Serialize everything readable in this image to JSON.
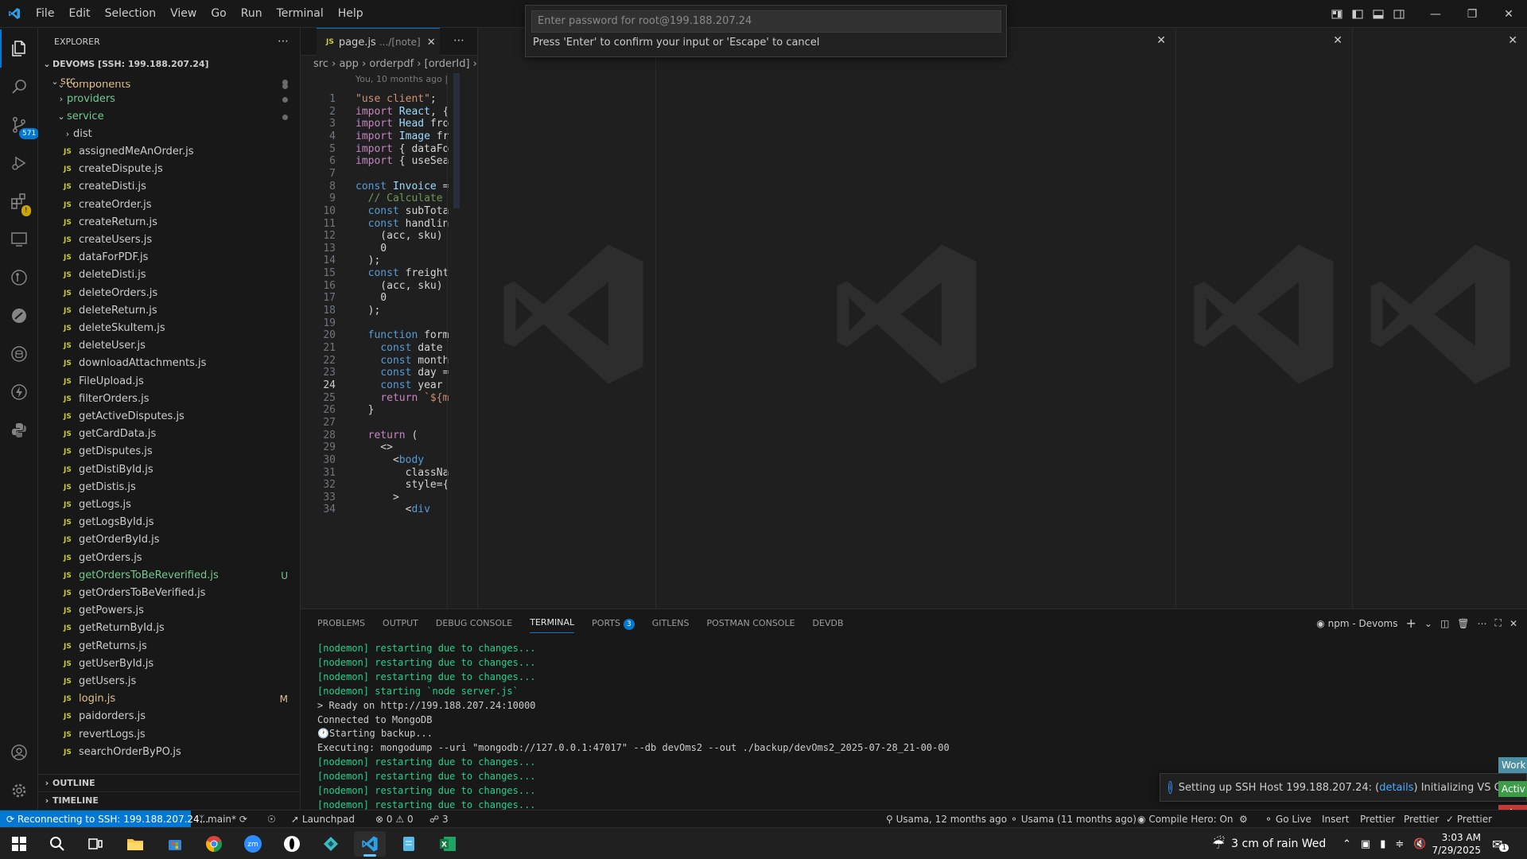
{
  "menu": [
    "File",
    "Edit",
    "Selection",
    "View",
    "Go",
    "Run",
    "Terminal",
    "Help"
  ],
  "quick_input": {
    "placeholder": "Enter password for root@199.188.207.24",
    "message": "Press 'Enter' to confirm your input or 'Escape' to cancel"
  },
  "activity": {
    "source_control_badge": "571"
  },
  "explorer": {
    "title": "EXPLORER",
    "root": "DEVOMS [SSH: 199.188.207.24]",
    "folders": {
      "src": "src",
      "components": "components",
      "providers": "providers",
      "service": "service",
      "dist": "dist"
    },
    "files": [
      {
        "name": "assignedMeAnOrder.js",
        "status": ""
      },
      {
        "name": "createDispute.js",
        "status": ""
      },
      {
        "name": "createDisti.js",
        "status": ""
      },
      {
        "name": "createOrder.js",
        "status": ""
      },
      {
        "name": "createReturn.js",
        "status": ""
      },
      {
        "name": "createUsers.js",
        "status": ""
      },
      {
        "name": "dataForPDF.js",
        "status": ""
      },
      {
        "name": "deleteDisti.js",
        "status": ""
      },
      {
        "name": "deleteOrders.js",
        "status": ""
      },
      {
        "name": "deleteReturn.js",
        "status": ""
      },
      {
        "name": "deleteSkuItem.js",
        "status": ""
      },
      {
        "name": "deleteUser.js",
        "status": ""
      },
      {
        "name": "downloadAttachments.js",
        "status": ""
      },
      {
        "name": "FileUpload.js",
        "status": ""
      },
      {
        "name": "filterOrders.js",
        "status": ""
      },
      {
        "name": "getActiveDisputes.js",
        "status": ""
      },
      {
        "name": "getCardData.js",
        "status": ""
      },
      {
        "name": "getDisputes.js",
        "status": ""
      },
      {
        "name": "getDistiById.js",
        "status": ""
      },
      {
        "name": "getDistis.js",
        "status": ""
      },
      {
        "name": "getLogs.js",
        "status": ""
      },
      {
        "name": "getLogsById.js",
        "status": ""
      },
      {
        "name": "getOrderById.js",
        "status": ""
      },
      {
        "name": "getOrders.js",
        "status": ""
      },
      {
        "name": "getOrdersToBeReverified.js",
        "status": "U"
      },
      {
        "name": "getOrdersToBeVerified.js",
        "status": ""
      },
      {
        "name": "getPowers.js",
        "status": ""
      },
      {
        "name": "getReturnById.js",
        "status": ""
      },
      {
        "name": "getReturns.js",
        "status": ""
      },
      {
        "name": "getUserById.js",
        "status": ""
      },
      {
        "name": "getUsers.js",
        "status": ""
      },
      {
        "name": "login.js",
        "status": "M"
      },
      {
        "name": "paidorders.js",
        "status": ""
      },
      {
        "name": "revertLogs.js",
        "status": ""
      },
      {
        "name": "searchOrderByPO.js",
        "status": ""
      }
    ],
    "outline": "OUTLINE",
    "timeline": "TIMELINE"
  },
  "editor": {
    "tab_label": "page.js",
    "tab_desc": ".../[note]",
    "breadcrumb": [
      "src",
      "app",
      "orderpdf",
      "[orderId]"
    ],
    "blame": "You, 10 months ago |",
    "current_line": 24,
    "lines": [
      "\"use client\";",
      "import React, {",
      "import Head fro",
      "import Image fr",
      "import { dataFo",
      "import { useSea",
      "",
      "const Invoice =",
      "  // Calculate",
      "  const subTota",
      "  const handlin",
      "    (acc, sku)",
      "    0",
      "  );",
      "  const freight",
      "    (acc, sku)",
      "    0",
      "  );",
      "",
      "  function form",
      "    const date",
      "    const month",
      "    const day =",
      "    const year",
      "    return `${m",
      "  }",
      "",
      "  return (",
      "    <>",
      "      <body",
      "        classNa",
      "        style={",
      "      >",
      "        <div"
    ]
  },
  "panel": {
    "tabs": [
      "PROBLEMS",
      "OUTPUT",
      "DEBUG CONSOLE",
      "TERMINAL",
      "PORTS",
      "GITLENS",
      "POSTMAN CONSOLE",
      "DEVDB"
    ],
    "active_tab": "TERMINAL",
    "ports_count": "3",
    "terminal_name": "npm - Devoms",
    "terminal_lines": [
      "[nodemon] restarting due to changes...",
      "[nodemon] restarting due to changes...",
      "[nodemon] restarting due to changes...",
      "[nodemon] starting `node server.js`",
      "> Ready on http://199.188.207.24:10000",
      "Connected to MongoDB",
      "🕐Starting backup...",
      "Executing: mongodump --uri \"mongodb://127.0.0.1:47017\" --db devOms2 --out ./backup/devOms2_2025-07-28_21-00-00",
      "[nodemon] restarting due to changes...",
      "[nodemon] restarting due to changes...",
      "[nodemon] restarting due to changes...",
      "[nodemon] restarting due to changes..."
    ]
  },
  "notification": {
    "prefix": "Setting up SSH Host 199.188.207.24: (",
    "link": "details",
    "suffix": ") Initializing VS Code Se"
  },
  "statusbar": {
    "remote": "Reconnecting to SSH: 199.188.207.24...",
    "branch": "main*",
    "launchpad": "Launchpad",
    "errors": "0",
    "warnings": "0",
    "ports": "3",
    "blame": "Usama, 12 months ago",
    "author": "Usama (11 months ago)",
    "compile_hero": "Compile Hero: On",
    "golive": "Go Live",
    "insert": "Insert",
    "prettier1": "Prettier",
    "prettier2": "Prettier",
    "prettier3": "Prettier"
  },
  "side_badges": [
    "Work",
    "Activ",
    "Ac"
  ],
  "taskbar": {
    "weather": "3 cm of rain Wed",
    "time": "3:03 AM",
    "date": "7/29/2025",
    "notif_count": "1"
  }
}
